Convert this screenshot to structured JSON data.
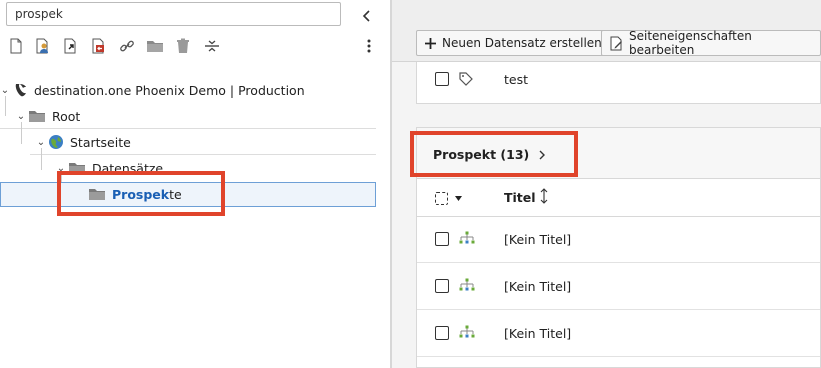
{
  "search": {
    "value": "prospek"
  },
  "tree": {
    "site": "destination.one Phoenix Demo | Production",
    "root": "Root",
    "startseite": "Startseite",
    "datensaetze": "Datensätze",
    "prospekte_match": "Prospek",
    "prospekte_rest": "te"
  },
  "toolbar": {
    "create_record": "Neuen Datensatz erstellen",
    "edit_page": "Seiteneigenschaften bearbeiten"
  },
  "records": {
    "test_label": "test",
    "section_title": "Prospekt (13)",
    "column_title": "Titel",
    "rows": [
      "[Kein Titel]",
      "[Kein Titel]",
      "[Kein Titel]"
    ]
  },
  "colors": {
    "highlight": "#e0442b",
    "accent": "#1a5fb4",
    "selection_bg": "#eef4fb"
  }
}
